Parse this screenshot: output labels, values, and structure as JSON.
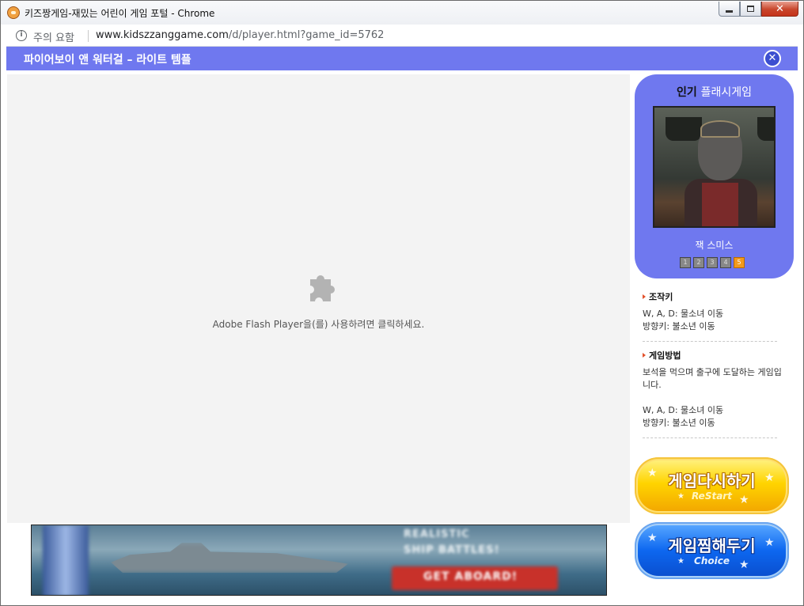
{
  "window": {
    "title": "키즈짱게임-재밌는 어린이 게임 포털 - Chrome"
  },
  "address": {
    "security_label": "주의 요함",
    "url_host": "www.kidszzanggame.com",
    "url_path": "/d/player.html?game_id=5762"
  },
  "header": {
    "game_title": "파이어보이 앤 워터걸 – 라이트 템플",
    "close_symbol": "✕"
  },
  "flash": {
    "message": "Adobe Flash Player을(를) 사용하려면 클릭하세요.",
    "icon": "puzzle-plugin-icon"
  },
  "ad": {
    "headline_line1": "REALISTIC",
    "headline_line2": "SHIP BATTLES!",
    "cta": "GET ABOARD!"
  },
  "sidebar": {
    "popular_title_prefix": "인기",
    "popular_title_highlight": "플래시게임",
    "featured_game_name": "잭 스미스",
    "pages": [
      "1",
      "2",
      "3",
      "4",
      "5"
    ],
    "active_page": 4,
    "controls_heading": "조작키",
    "controls_lines": [
      "W, A, D: 물소녀 이동",
      "방향키: 불소년 이동"
    ],
    "howto_heading": "게임방법",
    "howto_text": "보석을 먹으며 출구에 도달하는 게임입니다.",
    "howto_lines": [
      "W, A, D: 물소녀 이동",
      "방향키: 불소년 이동"
    ],
    "restart_label": "게임다시하기",
    "restart_sub": "ReStart",
    "choice_label": "게임찜해두기",
    "choice_sub": "Choice"
  },
  "colors": {
    "accent_blue": "#6f78ef",
    "restart_yellow": "#ffd400",
    "choice_blue": "#0d67f0",
    "active_page_orange": "#f29a1c"
  }
}
